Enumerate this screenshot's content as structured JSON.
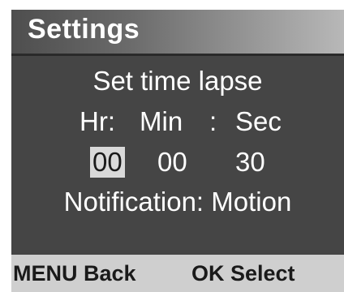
{
  "header": {
    "title": "Settings"
  },
  "panel": {
    "title": "Set time lapse",
    "labels": {
      "hr": "Hr:",
      "min": "Min",
      "colon": ":",
      "sec": "Sec"
    },
    "values": {
      "hr": "00",
      "min": "00",
      "sec": "30"
    },
    "notification": "Notification: Motion"
  },
  "footer": {
    "menu_label": "MENU Back",
    "ok_label": "OK Select"
  },
  "colors": {
    "header_gradient_start": "#4e4e4e",
    "header_gradient_end": "#b8b8b8",
    "panel_background": "#454545",
    "footer_background": "#cfcfcf",
    "selection_highlight": "#d9d9d9"
  }
}
